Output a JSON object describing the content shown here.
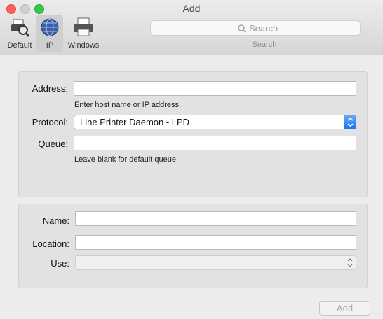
{
  "window": {
    "title": "Add"
  },
  "toolbar": {
    "items": [
      {
        "label": "Default",
        "icon": "default-printer-search-icon"
      },
      {
        "label": "IP",
        "icon": "globe-icon",
        "selected": true
      },
      {
        "label": "Windows",
        "icon": "printer-icon"
      }
    ],
    "search": {
      "placeholder": "Search",
      "caption": "Search"
    }
  },
  "form_ip": {
    "address_label": "Address:",
    "address_value": "",
    "address_hint": "Enter host name or IP address.",
    "protocol_label": "Protocol:",
    "protocol_value": "Line Printer Daemon - LPD",
    "queue_label": "Queue:",
    "queue_value": "",
    "queue_hint": "Leave blank for default queue."
  },
  "form_info": {
    "name_label": "Name:",
    "name_value": "",
    "location_label": "Location:",
    "location_value": "",
    "use_label": "Use:",
    "use_value": ""
  },
  "actions": {
    "add_label": "Add"
  },
  "colors": {
    "accent": "#1a73e8",
    "close": "#fc605c",
    "zoom": "#34c84a"
  }
}
